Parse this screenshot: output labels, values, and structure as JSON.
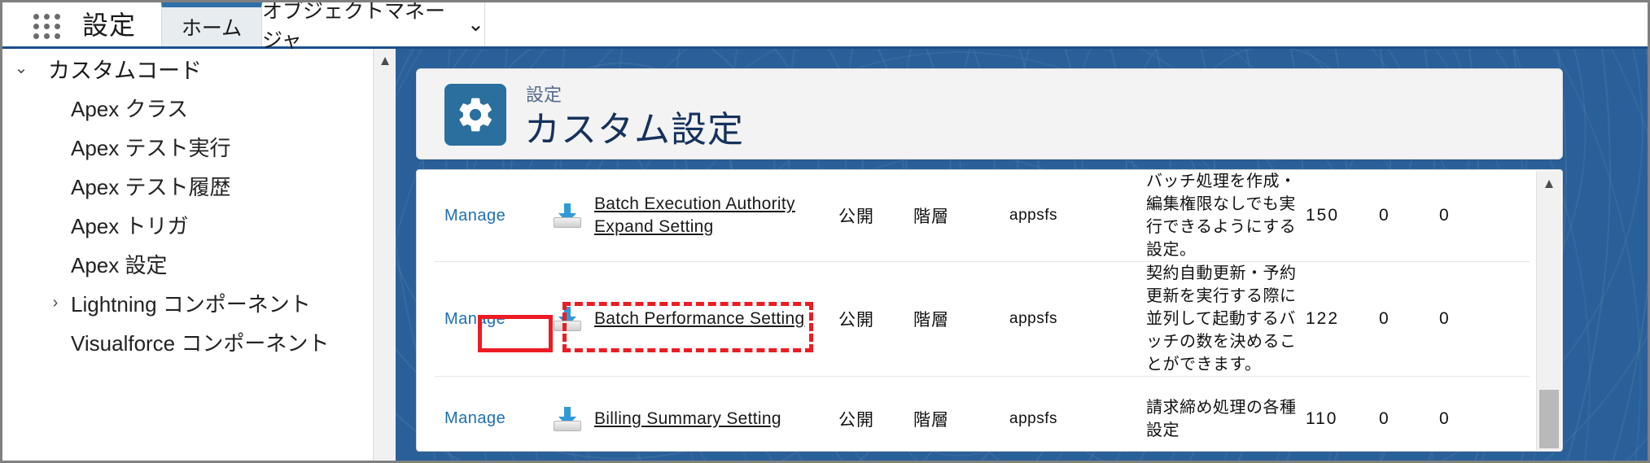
{
  "topbar": {
    "app_launcher": "app-launcher-icon",
    "brand": "設定",
    "tabs": [
      {
        "label": "ホーム",
        "active": true
      },
      {
        "label": "オブジェクトマネージャ",
        "active": false,
        "chevron": "⌄"
      }
    ]
  },
  "sidebar": {
    "items": [
      {
        "label": "カスタムコード",
        "level": 0,
        "twisty": "⌄",
        "expanded": true
      },
      {
        "label": "Apex クラス",
        "level": 1,
        "twisty": ""
      },
      {
        "label": "Apex テスト実行",
        "level": 1,
        "twisty": ""
      },
      {
        "label": "Apex テスト履歴",
        "level": 1,
        "twisty": ""
      },
      {
        "label": "Apex トリガ",
        "level": 1,
        "twisty": ""
      },
      {
        "label": "Apex 設定",
        "level": 1,
        "twisty": ""
      },
      {
        "label": "Lightning コンポーネント",
        "level": 1,
        "twisty": "›",
        "collapsed": true
      },
      {
        "label": "Visualforce コンポーネント",
        "level": 1,
        "twisty": ""
      }
    ],
    "scroll_up_arrow": "▲"
  },
  "page_header": {
    "icon": "gear-icon",
    "eyebrow": "設定",
    "title": "カスタム設定",
    "icon_color": "#2a6f9e"
  },
  "table": {
    "scroll_up_arrow": "▲",
    "rows": [
      {
        "manage": "Manage",
        "icon": "download-icon",
        "name": "Batch Execution Authority Expand Setting",
        "visibility": "公開",
        "type": "階層",
        "namespace": "appsfs",
        "description": "バッチ処理を作成・編集権限なしでも実行できるようにする設定。",
        "n1": "150",
        "n2": "0",
        "n3": "0",
        "highlight": "none"
      },
      {
        "manage": "Manage",
        "icon": "download-icon",
        "name": "Batch Performance Setting",
        "visibility": "公開",
        "type": "階層",
        "namespace": "appsfs",
        "description": "契約自動更新・予約更新を実行する際に並列して起動するバッチの数を決めることができます。",
        "n1": "122",
        "n2": "0",
        "n3": "0",
        "highlight": "manage-solid-and-name-dashed"
      },
      {
        "manage": "Manage",
        "icon": "download-icon",
        "name": "Billing Summary Setting",
        "visibility": "公開",
        "type": "階層",
        "namespace": "appsfs",
        "description": "請求締め処理の各種設定",
        "n1": "110",
        "n2": "0",
        "n3": "0",
        "highlight": "none"
      }
    ]
  },
  "annotation": {
    "color": "#ec1c24",
    "solid_target": "Manage",
    "dashed_target": "Batch Performance Setting"
  }
}
